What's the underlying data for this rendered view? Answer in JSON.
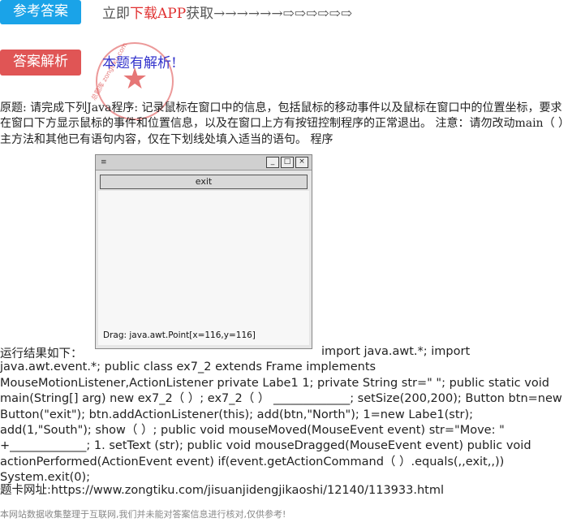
{
  "header": {
    "answer_button": "参考答案",
    "topline_prefix": "立即",
    "topline_red": "下载APP",
    "topline_suffix": "获取→→→→→→⇨⇨⇨⇨⇨⇨"
  },
  "analysis": {
    "button": "答案解析",
    "link": "本题有解析!",
    "stamp_text": "总题库 zongtiku.com"
  },
  "question": {
    "text": "原题: 请完成下列Java程序: 记录鼠标在窗口中的信息，包括鼠标的移动事件以及鼠标在窗口中的位置坐标，要求在窗口下方显示鼠标的事件和位置信息，以及在窗口上方有按钮控制程序的正常退出。 注意：请勿改动main（ ）主方法和其他已有语句内容，仅在下划线处填入适当的语句。 程序"
  },
  "figure": {
    "exit_label": "exit",
    "status": "Drag: java.awt.Point[x=116,y=116]",
    "titlebar_glyph": "≡"
  },
  "run_label": "运行结果如下：",
  "code": {
    "text": "import java.awt.*; import java.awt.event.*; public class ex7_2 extends Frame implements MouseMotionListener,ActionListener private Labe1 1; private String str=\" \"; public static void main(String[] arg) new ex7_2（ ）; ex7_2（ ） _____________; setSize(200,200); Button btn=new Button(\"exit\"); btn.addActionListener(this); add(btn,\"North\"); 1=new Labe1(str); add(1,\"South\"); show（ ）; public void mouseMoved(MouseEvent event) str=\"Move: \" +_____________; 1. setText (str); public void mouseDragged(MouseEvent event) public void actionPerformed(ActionEvent event) if(event.getActionCommand（ ）.equals(,,exit,,)) System.exit(0);"
  },
  "footer": {
    "url": "题卡网址:https://www.zongtiku.com/jisuanjidengjikaoshi/12140/113933.html",
    "disclaimer": "本网站数据收集整理于互联网,我们并未能对答案信息进行核对,仅供参考!"
  }
}
